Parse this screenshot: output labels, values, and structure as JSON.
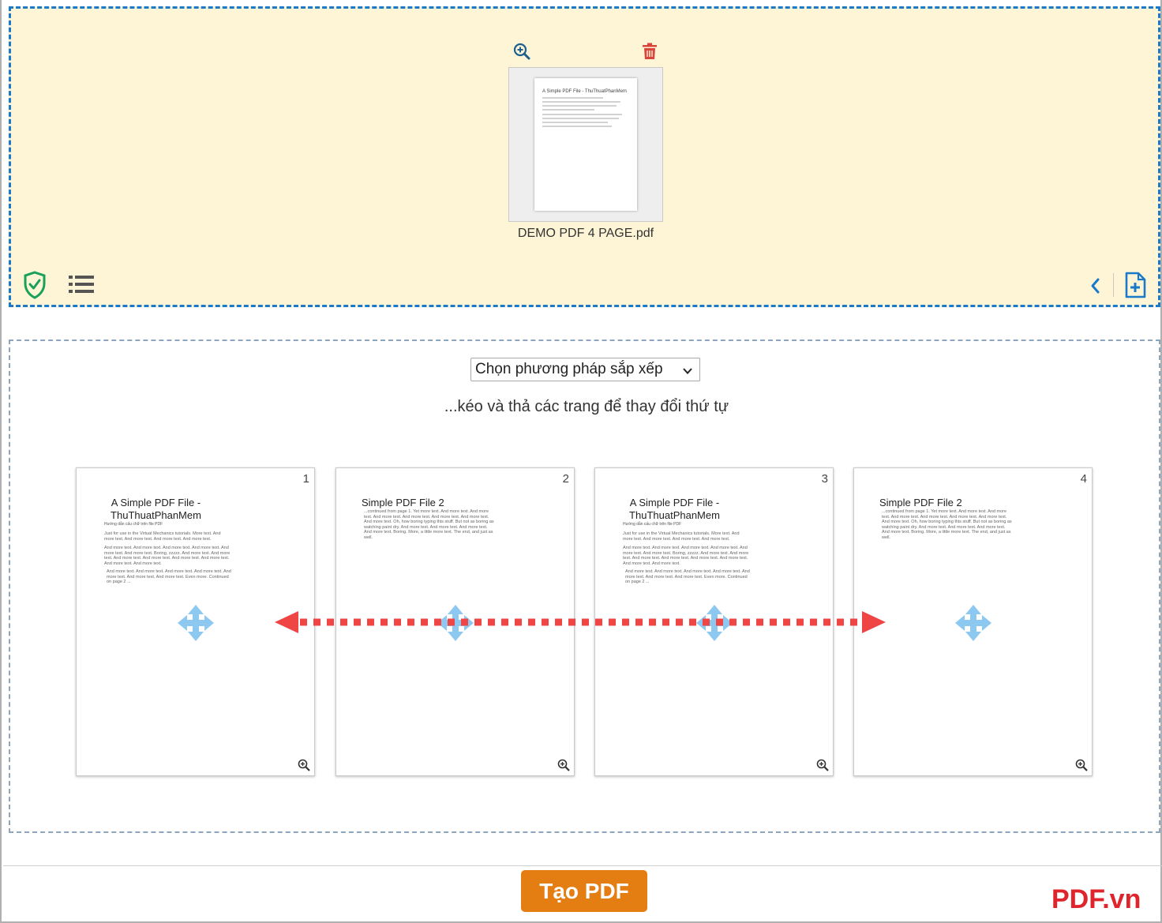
{
  "upload": {
    "file_name": "DEMO PDF 4 PAGE.pdf",
    "thumb_title": "A Simple PDF File - ThuThuatPhanMem",
    "icons": {
      "zoom": "zoom-in-icon",
      "delete": "trash-icon",
      "shield": "shield-check-icon",
      "list": "list-view-icon",
      "collapse": "chevron-left-icon",
      "add_file": "add-file-icon"
    }
  },
  "sort": {
    "select_label": "Chọn phương pháp sắp xếp",
    "hint": "...kéo và thả các trang để thay đổi thứ tự"
  },
  "pages": [
    {
      "number": "1",
      "title": "A Simple PDF File - ThuThuatPhanMem",
      "subtitle": "Hướng dẫn cấu chữ trên file PDF",
      "p1": "Just for use in the Virtual Mechanics tutorials. More text. And more text. And more text. And more text. And more text.",
      "p2": "And more text. And more text. And more text. And more text. And more text. And more text. Boring, zzzzz. And more text. And more text. And more text. And more text. And more text. And more text. And more text. And more text.",
      "p3": "And more text. And more text. And more text. And more text. And more text. And more text. And more text. Even more. Continued on page 2 ..."
    },
    {
      "number": "2",
      "title": "Simple PDF File 2",
      "p1": "...continued from page 1. Yet more text. And more text. And more text. And more text. And more text. And more text. And more text. And more text. Oh, how boring typing this stuff. But not as boring as watching paint dry. And more text. And more text. And more text. And more text. Boring. More, a little more text. The end, and just as well."
    },
    {
      "number": "3",
      "title": "A Simple PDF File - ThuThuatPhanMem",
      "subtitle": "Hướng dẫn cấu chữ trên file PDF",
      "p1": "Just for use in the Virtual Mechanics tutorials. More text. And more text. And more text. And more text. And more text.",
      "p2": "And more text. And more text. And more text. And more text. And more text. And more text. Boring, zzzzz. And more text. And more text. And more text. And more text. And more text. And more text. And more text. And more text.",
      "p3": "And more text. And more text. And more text. And more text. And more text. And more text. And more text. Even more. Continued on page 2 ..."
    },
    {
      "number": "4",
      "title": "Simple PDF File 2",
      "p1": "...continued from page 1. Yet more text. And more text. And more text. And more text. And more text. And more text. And more text. And more text. Oh, how boring typing this stuff. But not as boring as watching paint dry. And more text. And more text. And more text. And more text. Boring. More, a little more text. The end, and just as well."
    }
  ],
  "actions": {
    "create_label": "Tạo PDF"
  },
  "brand": "PDF.vn",
  "colors": {
    "upload_bg": "#fdf5d5",
    "upload_border": "#1a7ac9",
    "button": "#e47d12",
    "brand": "#e0242c",
    "arrow": "#f04545",
    "move_icon": "#8cc8f0"
  }
}
